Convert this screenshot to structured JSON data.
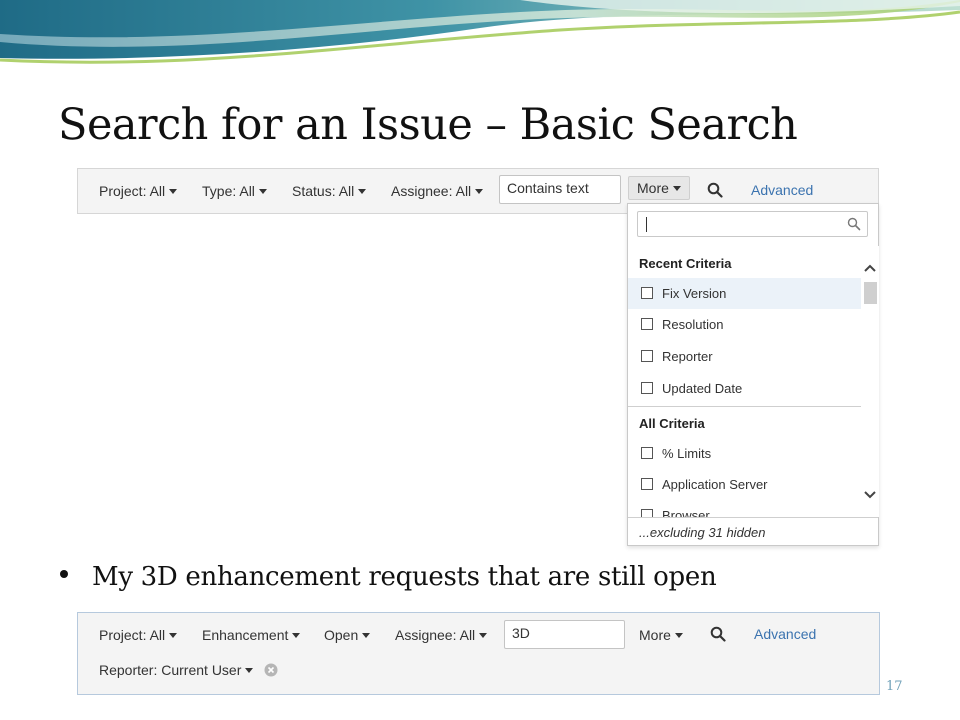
{
  "slide": {
    "title": "Search for an Issue – Basic Search",
    "bullet": "My 3D enhancement requests that are still open",
    "page_number": "17"
  },
  "search_bar_1": {
    "criteria": [
      "Project: All",
      "Type: All",
      "Status: All",
      "Assignee: All"
    ],
    "text_field_value": "Contains text",
    "more_label": "More",
    "advanced_label": "Advanced"
  },
  "more_dropdown": {
    "search_value": "",
    "recent_heading": "Recent Criteria",
    "recent_items": [
      "Fix Version",
      "Resolution",
      "Reporter",
      "Updated Date"
    ],
    "all_heading": "All Criteria",
    "all_items": [
      "% Limits",
      "Application Server",
      "Browser"
    ],
    "footer": "...excluding 31 hidden",
    "highlighted_item": "Fix Version"
  },
  "search_bar_2": {
    "criteria": [
      "Project: All",
      "Enhancement",
      "Open",
      "Assignee: All"
    ],
    "text_field_value": "3D",
    "more_label": "More",
    "advanced_label": "Advanced",
    "reporter_criteria": "Reporter: Current User"
  },
  "colors": {
    "link": "#3b73af",
    "bar_background": "#f4f4f4",
    "highlight": "#ebf2f9",
    "wave_teal": "#2f7f95",
    "wave_green": "#9cc54a"
  }
}
